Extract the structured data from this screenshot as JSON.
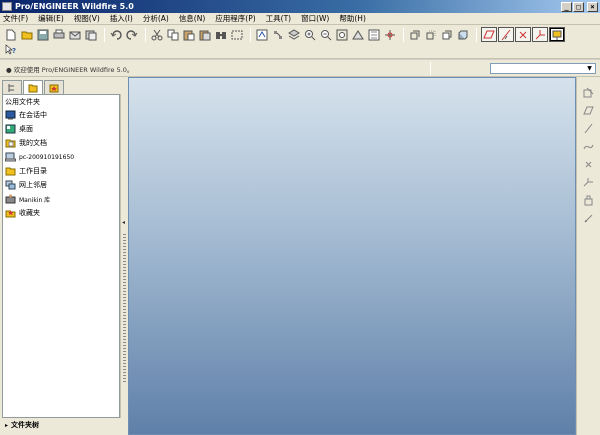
{
  "window": {
    "title": "Pro/ENGINEER Wildfire 5.0",
    "minimize_label": "_",
    "maximize_label": "□",
    "close_label": "×"
  },
  "menu": {
    "items": [
      "文件(F)",
      "编辑(E)",
      "视图(V)",
      "插入(I)",
      "分析(A)",
      "信息(N)",
      "应用程序(P)",
      "工具(T)",
      "窗口(W)",
      "帮助(H)"
    ]
  },
  "toolbar": {
    "row1": [
      "new-icon",
      "open-icon",
      "save-icon",
      "print-icon",
      "email-icon",
      "copy-window-icon",
      "undo-icon",
      "redo-icon",
      "cut-icon",
      "copy-icon",
      "paste-icon",
      "paste-special-icon",
      "find-icon",
      "select-box-icon",
      "regenerate-icon",
      "regenerate-manager-icon",
      "layers-icon",
      "zoom-in-icon",
      "zoom-out-icon",
      "refit-icon",
      "reorient-icon",
      "saved-views-icon",
      "spin-center-icon",
      "wireframe-icon",
      "hidden-line-icon",
      "no-hidden-icon",
      "shading-icon",
      "datum-plane-display-icon",
      "datum-axis-display-icon",
      "datum-point-display-icon",
      "coordinate-system-display-icon",
      "annotation-display-icon"
    ],
    "row2": [
      "context-help-icon"
    ],
    "colors": {
      "accent": "#0a246a",
      "icon_blue": "#2c5aa0",
      "icon_yellow": "#f0c020"
    }
  },
  "message": {
    "text": "● 欢迎使用 Pro/ENGINEER Wildfire 5.0。",
    "filter_value": ""
  },
  "navigator": {
    "tabs": [
      "model-tree-tab-icon",
      "folder-browser-tab-icon",
      "favorites-tab-icon"
    ],
    "header": "公用文件夹",
    "items": [
      {
        "label": "在会话中",
        "icon": "session-icon"
      },
      {
        "label": "桌面",
        "icon": "desktop-icon"
      },
      {
        "label": "我的文档",
        "icon": "my-documents-icon"
      },
      {
        "label": "pc-200910191650",
        "icon": "computer-icon"
      },
      {
        "label": "工作目录",
        "icon": "working-directory-icon"
      },
      {
        "label": "网上邻居",
        "icon": "network-icon"
      },
      {
        "label": "Manikin 库",
        "icon": "manikin-library-icon"
      },
      {
        "label": "收藏夹",
        "icon": "favorites-icon"
      }
    ],
    "footer": "文件夹树"
  },
  "right_toolbar": {
    "items": [
      "sketch-icon",
      "plane-icon",
      "axis-icon",
      "curve-icon",
      "point-icon",
      "csys-icon",
      "analysis-icon",
      "annotation-icon"
    ]
  }
}
